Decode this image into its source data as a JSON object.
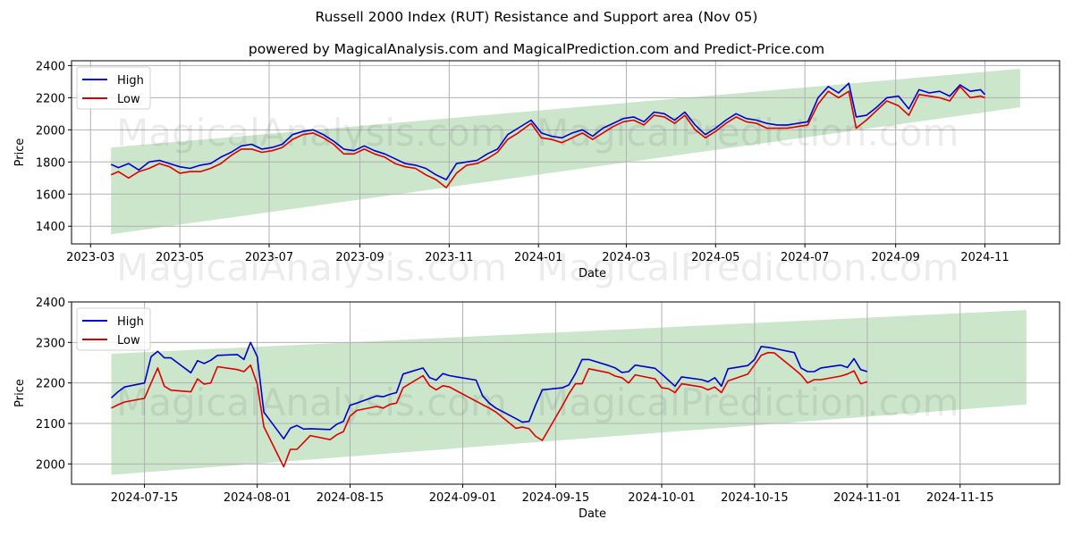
{
  "header": {
    "title": "Russell 2000 Index (RUT) Resistance and Support area (Nov 05)",
    "subtitle": "powered by MagicalAnalysis.com and MagicalPrediction.com and Predict-Price.com"
  },
  "watermarks": [
    "MagicalAnalysis.com",
    "MagicalPrediction.com"
  ],
  "colors": {
    "high": "#0000cc",
    "low": "#dd0000",
    "band": "#a8d5a8"
  },
  "chart_data": [
    {
      "type": "line",
      "title": "",
      "xlabel": "Date",
      "ylabel": "Price",
      "ylim": [
        1290,
        2430
      ],
      "xlim": [
        "2023-02-16",
        "2024-12-22"
      ],
      "yticks": [
        1400,
        1600,
        1800,
        2000,
        2200,
        2400
      ],
      "xticks": [
        "2023-03",
        "2023-05",
        "2023-07",
        "2023-09",
        "2023-11",
        "2024-01",
        "2024-03",
        "2024-05",
        "2024-07",
        "2024-09",
        "2024-11"
      ],
      "xtick_dates": [
        "2023-03-01",
        "2023-05-01",
        "2023-07-01",
        "2023-09-01",
        "2023-11-01",
        "2024-01-01",
        "2024-03-01",
        "2024-05-01",
        "2024-07-01",
        "2024-09-01",
        "2024-11-01"
      ],
      "grid": true,
      "legend": {
        "position": "top-left",
        "entries": [
          "High",
          "Low"
        ]
      },
      "band": {
        "name": "Resistance and Support area",
        "x": [
          "2023-03-15",
          "2024-11-25"
        ],
        "upper": [
          1890,
          2380
        ],
        "lower": [
          1350,
          2140
        ]
      },
      "x": [
        "2023-03-15",
        "2023-03-20",
        "2023-03-27",
        "2023-04-03",
        "2023-04-10",
        "2023-04-17",
        "2023-04-24",
        "2023-05-01",
        "2023-05-08",
        "2023-05-15",
        "2023-05-22",
        "2023-05-29",
        "2023-06-05",
        "2023-06-12",
        "2023-06-19",
        "2023-06-26",
        "2023-07-03",
        "2023-07-10",
        "2023-07-17",
        "2023-07-24",
        "2023-07-31",
        "2023-08-07",
        "2023-08-14",
        "2023-08-21",
        "2023-08-28",
        "2023-09-04",
        "2023-09-11",
        "2023-09-18",
        "2023-09-25",
        "2023-10-02",
        "2023-10-09",
        "2023-10-16",
        "2023-10-23",
        "2023-10-30",
        "2023-11-06",
        "2023-11-13",
        "2023-11-20",
        "2023-11-27",
        "2023-12-04",
        "2023-12-11",
        "2023-12-18",
        "2023-12-27",
        "2024-01-03",
        "2024-01-10",
        "2024-01-17",
        "2024-01-24",
        "2024-01-31",
        "2024-02-07",
        "2024-02-14",
        "2024-02-21",
        "2024-02-28",
        "2024-03-06",
        "2024-03-13",
        "2024-03-20",
        "2024-03-27",
        "2024-04-03",
        "2024-04-10",
        "2024-04-17",
        "2024-04-24",
        "2024-05-01",
        "2024-05-08",
        "2024-05-15",
        "2024-05-22",
        "2024-05-29",
        "2024-06-05",
        "2024-06-12",
        "2024-06-19",
        "2024-06-26",
        "2024-07-03",
        "2024-07-10",
        "2024-07-17",
        "2024-07-24",
        "2024-07-31",
        "2024-08-05",
        "2024-08-12",
        "2024-08-19",
        "2024-08-26",
        "2024-09-03",
        "2024-09-10",
        "2024-09-17",
        "2024-09-24",
        "2024-10-01",
        "2024-10-08",
        "2024-10-15",
        "2024-10-22",
        "2024-10-29",
        "2024-11-01"
      ],
      "series": [
        {
          "name": "High",
          "values": [
            1785,
            1765,
            1790,
            1750,
            1800,
            1810,
            1790,
            1770,
            1760,
            1780,
            1790,
            1830,
            1860,
            1900,
            1910,
            1880,
            1890,
            1910,
            1970,
            1990,
            2000,
            1970,
            1930,
            1880,
            1870,
            1900,
            1870,
            1850,
            1820,
            1790,
            1780,
            1760,
            1720,
            1690,
            1790,
            1800,
            1810,
            1850,
            1880,
            1970,
            2010,
            2060,
            1980,
            1960,
            1950,
            1980,
            2000,
            1960,
            2010,
            2040,
            2070,
            2080,
            2050,
            2110,
            2100,
            2060,
            2110,
            2030,
            1970,
            2010,
            2060,
            2100,
            2070,
            2060,
            2040,
            2030,
            2030,
            2040,
            2050,
            2200,
            2270,
            2230,
            2290,
            2080,
            2090,
            2140,
            2200,
            2210,
            2130,
            2250,
            2230,
            2240,
            2210,
            2280,
            2240,
            2250,
            2220
          ]
        },
        {
          "name": "Low",
          "values": [
            1720,
            1740,
            1700,
            1740,
            1760,
            1790,
            1770,
            1730,
            1740,
            1740,
            1760,
            1790,
            1840,
            1880,
            1880,
            1860,
            1870,
            1890,
            1940,
            1970,
            1980,
            1950,
            1910,
            1850,
            1850,
            1880,
            1850,
            1830,
            1790,
            1770,
            1760,
            1720,
            1690,
            1640,
            1730,
            1780,
            1790,
            1820,
            1860,
            1940,
            1980,
            2040,
            1950,
            1940,
            1920,
            1950,
            1980,
            1940,
            1980,
            2020,
            2050,
            2060,
            2030,
            2090,
            2080,
            2040,
            2090,
            2000,
            1950,
            1990,
            2040,
            2080,
            2050,
            2040,
            2010,
            2010,
            2010,
            2020,
            2030,
            2160,
            2240,
            2200,
            2240,
            2010,
            2060,
            2120,
            2180,
            2150,
            2090,
            2220,
            2210,
            2200,
            2180,
            2270,
            2200,
            2210,
            2200
          ]
        }
      ]
    },
    {
      "type": "line",
      "title": "",
      "xlabel": "Date",
      "ylabel": "Price",
      "ylim": [
        1950,
        2400
      ],
      "xlim": [
        "2024-07-04",
        "2024-11-30"
      ],
      "yticks": [
        2000,
        2100,
        2200,
        2300,
        2400
      ],
      "xticks": [
        "2024-07-15",
        "2024-08-01",
        "2024-08-15",
        "2024-09-01",
        "2024-09-15",
        "2024-10-01",
        "2024-10-15",
        "2024-11-01",
        "2024-11-15"
      ],
      "grid": true,
      "legend": {
        "position": "top-left",
        "entries": [
          "High",
          "Low"
        ]
      },
      "band": {
        "name": "Resistance and Support area",
        "x": [
          "2024-07-10",
          "2024-11-25"
        ],
        "upper": [
          2272,
          2380
        ],
        "lower": [
          1973,
          2147
        ]
      },
      "x": [
        "2024-07-10",
        "2024-07-11",
        "2024-07-12",
        "2024-07-15",
        "2024-07-16",
        "2024-07-17",
        "2024-07-18",
        "2024-07-19",
        "2024-07-22",
        "2024-07-23",
        "2024-07-24",
        "2024-07-25",
        "2024-07-26",
        "2024-07-29",
        "2024-07-30",
        "2024-07-31",
        "2024-08-01",
        "2024-08-02",
        "2024-08-05",
        "2024-08-06",
        "2024-08-07",
        "2024-08-08",
        "2024-08-09",
        "2024-08-12",
        "2024-08-13",
        "2024-08-14",
        "2024-08-15",
        "2024-08-16",
        "2024-08-19",
        "2024-08-20",
        "2024-08-21",
        "2024-08-22",
        "2024-08-23",
        "2024-08-26",
        "2024-08-27",
        "2024-08-28",
        "2024-08-29",
        "2024-08-30",
        "2024-09-03",
        "2024-09-04",
        "2024-09-05",
        "2024-09-06",
        "2024-09-09",
        "2024-09-10",
        "2024-09-11",
        "2024-09-12",
        "2024-09-13",
        "2024-09-16",
        "2024-09-17",
        "2024-09-18",
        "2024-09-19",
        "2024-09-20",
        "2024-09-23",
        "2024-09-24",
        "2024-09-25",
        "2024-09-26",
        "2024-09-27",
        "2024-09-30",
        "2024-10-01",
        "2024-10-02",
        "2024-10-03",
        "2024-10-04",
        "2024-10-07",
        "2024-10-08",
        "2024-10-09",
        "2024-10-10",
        "2024-10-11",
        "2024-10-14",
        "2024-10-15",
        "2024-10-16",
        "2024-10-17",
        "2024-10-18",
        "2024-10-21",
        "2024-10-22",
        "2024-10-23",
        "2024-10-24",
        "2024-10-25",
        "2024-10-28",
        "2024-10-29",
        "2024-10-30",
        "2024-10-31",
        "2024-11-01"
      ],
      "series": [
        {
          "name": "High",
          "values": [
            2163,
            2178,
            2190,
            2200,
            2265,
            2278,
            2262,
            2262,
            2225,
            2255,
            2248,
            2256,
            2268,
            2270,
            2258,
            2300,
            2265,
            2128,
            2062,
            2088,
            2095,
            2086,
            2087,
            2085,
            2098,
            2105,
            2145,
            2150,
            2168,
            2166,
            2172,
            2176,
            2222,
            2237,
            2213,
            2207,
            2223,
            2218,
            2207,
            2168,
            2150,
            2138,
            2112,
            2103,
            2105,
            2146,
            2183,
            2188,
            2195,
            2223,
            2258,
            2258,
            2243,
            2237,
            2226,
            2228,
            2244,
            2236,
            2222,
            2207,
            2192,
            2215,
            2208,
            2203,
            2213,
            2192,
            2235,
            2243,
            2258,
            2290,
            2288,
            2285,
            2275,
            2237,
            2228,
            2228,
            2237,
            2244,
            2238,
            2260,
            2233,
            2228
          ]
        },
        {
          "name": "Low",
          "values": [
            2138,
            2146,
            2153,
            2162,
            2200,
            2237,
            2192,
            2182,
            2178,
            2210,
            2197,
            2200,
            2240,
            2233,
            2228,
            2244,
            2197,
            2092,
            1993,
            2036,
            2036,
            2053,
            2070,
            2060,
            2072,
            2080,
            2118,
            2132,
            2142,
            2138,
            2147,
            2150,
            2188,
            2218,
            2193,
            2183,
            2193,
            2190,
            2155,
            2146,
            2138,
            2128,
            2088,
            2091,
            2087,
            2068,
            2058,
            2143,
            2173,
            2198,
            2198,
            2235,
            2225,
            2217,
            2213,
            2200,
            2220,
            2210,
            2188,
            2186,
            2176,
            2198,
            2190,
            2183,
            2190,
            2176,
            2205,
            2222,
            2245,
            2268,
            2275,
            2274,
            2234,
            2220,
            2200,
            2208,
            2208,
            2217,
            2222,
            2230,
            2198,
            2203
          ]
        }
      ]
    }
  ]
}
